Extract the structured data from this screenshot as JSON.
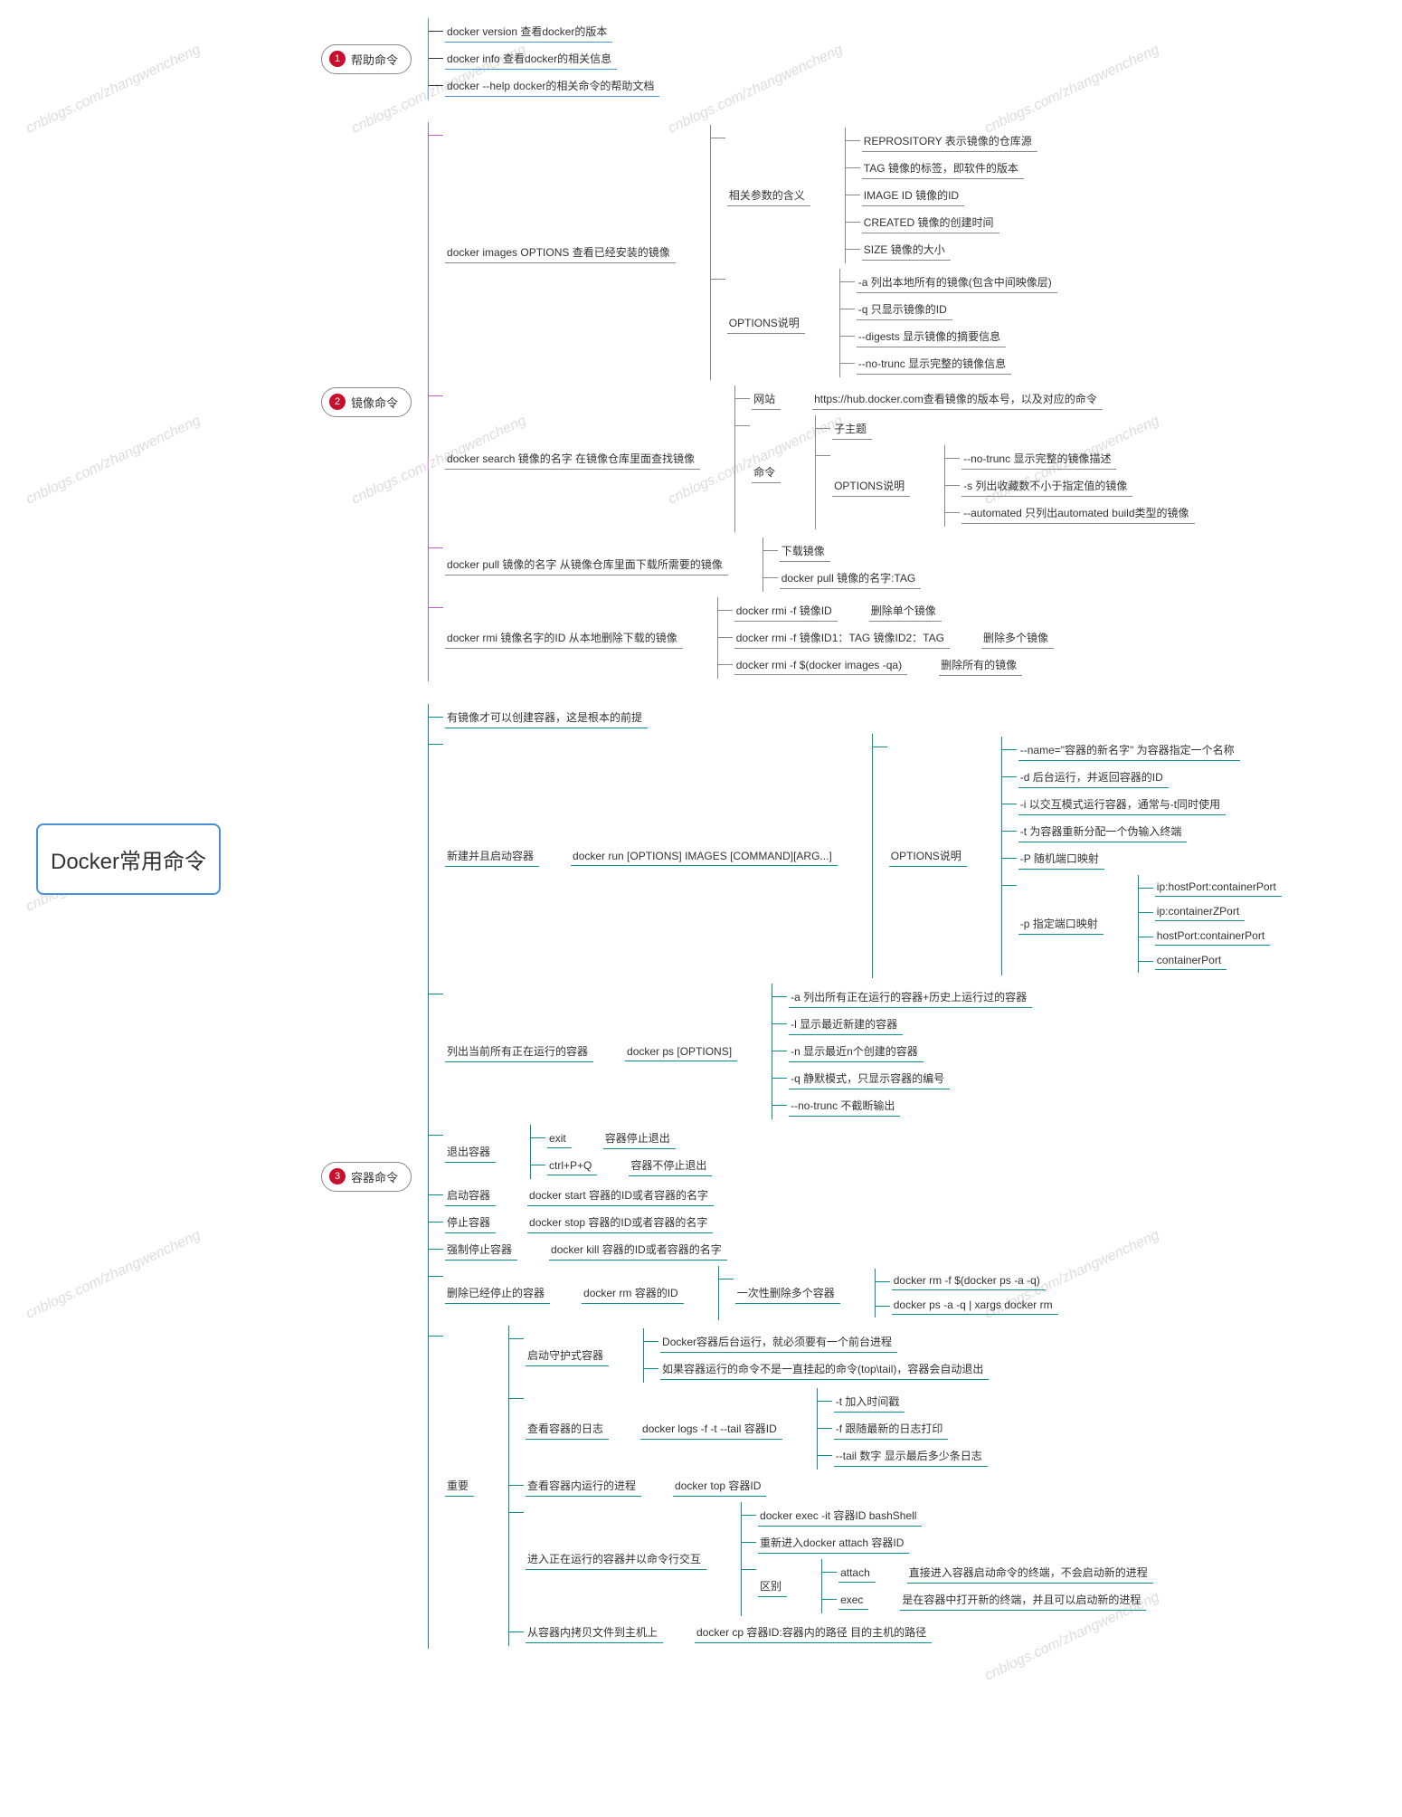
{
  "watermark": "cnblogs.com/zhangwencheng",
  "root": "Docker常用命令",
  "sections": [
    {
      "num": "1",
      "title": "帮助命令",
      "items": [
        "docker version  查看docker的版本",
        "docker info  查看docker的相关信息",
        "docker --help  docker的相关命令的帮助文档"
      ]
    },
    {
      "num": "2",
      "title": "镜像命令",
      "items": [
        {
          "label": "docker images  OPTIONS 查看已经安装的镜像",
          "children": [
            {
              "label": "相关参数的含义",
              "children": [
                "REPROSITORY 表示镜像的仓库源",
                "TAG 镜像的标签，即软件的版本",
                "IMAGE ID 镜像的ID",
                "CREATED 镜像的创建时间",
                "SIZE 镜像的大小"
              ]
            },
            {
              "label": "OPTIONS说明",
              "children": [
                "-a 列出本地所有的镜像(包含中间映像层)",
                "-q 只显示镜像的ID",
                "--digests 显示镜像的摘要信息",
                "--no-trunc 显示完整的镜像信息"
              ]
            }
          ]
        },
        {
          "label": "docker search 镜像的名字   在镜像仓库里面查找镜像",
          "children": [
            {
              "label": "网站",
              "tail": "https://hub.docker.com查看镜像的版本号，以及对应的命令"
            },
            {
              "label": "命令",
              "children": [
                "子主题",
                {
                  "label": "OPTIONS说明",
                  "children": [
                    "--no-trunc 显示完整的镜像描述",
                    "-s 列出收藏数不小于指定值的镜像",
                    "--automated  只列出automated build类型的镜像"
                  ]
                }
              ]
            }
          ]
        },
        {
          "label": "docker pull 镜像的名字   从镜像仓库里面下载所需要的镜像",
          "children": [
            "下载镜像",
            "docker pull 镜像的名字:TAG"
          ]
        },
        {
          "label": "docker rmi 镜像名字的ID  从本地删除下载的镜像",
          "children": [
            {
              "label": "docker rmi -f 镜像ID",
              "tail": "删除单个镜像"
            },
            {
              "label": "docker rmi -f 镜像ID1：TAG  镜像ID2：TAG",
              "tail": "删除多个镜像"
            },
            {
              "label": "docker rmi -f $(docker images -qa)",
              "tail": "删除所有的镜像"
            }
          ]
        }
      ]
    },
    {
      "num": "3",
      "title": "容器命令",
      "items": [
        "有镜像才可以创建容器，这是根本的前提",
        {
          "label": "新建并且启动容器",
          "tail": "docker run [OPTIONS] IMAGES [COMMAND][ARG...]",
          "children": [
            {
              "label": "OPTIONS说明",
              "children": [
                "--name=\"容器的新名字\"  为容器指定一个名称",
                "-d 后台运行，并返回容器的ID",
                "-i 以交互模式运行容器，通常与-t同时使用",
                "-t 为容器重新分配一个伪输入终端",
                "-P 随机端口映射",
                {
                  "label": "-p 指定端口映射",
                  "children": [
                    "ip:hostPort:containerPort",
                    "ip:containerZPort",
                    "hostPort:containerPort",
                    "containerPort"
                  ]
                }
              ]
            }
          ]
        },
        {
          "label": "列出当前所有正在运行的容器",
          "tail": "docker ps [OPTIONS]",
          "children": [
            "-a 列出所有正在运行的容器+历史上运行过的容器",
            "-l 显示最近新建的容器",
            "-n 显示最近n个创建的容器",
            "-q 静默模式，只显示容器的编号",
            "--no-trunc 不截断输出"
          ]
        },
        {
          "label": "退出容器",
          "children": [
            {
              "label": "exit",
              "tail": "容器停止退出"
            },
            {
              "label": "ctrl+P+Q",
              "tail": "容器不停止退出"
            }
          ]
        },
        {
          "label": "启动容器",
          "tail": "docker start 容器的ID或者容器的名字"
        },
        {
          "label": "停止容器",
          "tail": "docker stop 容器的ID或者容器的名字"
        },
        {
          "label": "强制停止容器",
          "tail": "docker kill 容器的ID或者容器的名字"
        },
        {
          "label": "删除已经停止的容器",
          "tail": "docker rm 容器的ID",
          "children": [
            {
              "label": "一次性删除多个容器",
              "children": [
                "docker rm -f $(docker ps -a -q)",
                "docker ps -a -q | xargs docker rm"
              ]
            }
          ]
        },
        {
          "label": "重要",
          "children": [
            {
              "label": "启动守护式容器",
              "children": [
                "Docker容器后台运行，就必须要有一个前台进程",
                "如果容器运行的命令不是一直挂起的命令(top\\tail)，容器会自动退出"
              ]
            },
            {
              "label": "查看容器的日志",
              "tail": "docker logs -f -t --tail 容器ID",
              "children": [
                "-t 加入时间戳",
                "-f 跟随最新的日志打印",
                "--tail 数字 显示最后多少条日志"
              ]
            },
            {
              "label": "查看容器内运行的进程",
              "tail": "docker top 容器ID"
            },
            {
              "label": "进入正在运行的容器并以命令行交互",
              "children": [
                "docker exec -it 容器ID bashShell",
                "重新进入docker attach 容器ID",
                {
                  "label": "区别",
                  "children": [
                    {
                      "label": "attach",
                      "tail": "直接进入容器启动命令的终端，不会启动新的进程"
                    },
                    {
                      "label": "exec",
                      "tail": "是在容器中打开新的终端，并且可以启动新的进程"
                    }
                  ]
                }
              ]
            },
            {
              "label": "从容器内拷贝文件到主机上",
              "tail": "docker cp 容器ID:容器内的路径 目的主机的路径"
            }
          ]
        }
      ]
    }
  ]
}
